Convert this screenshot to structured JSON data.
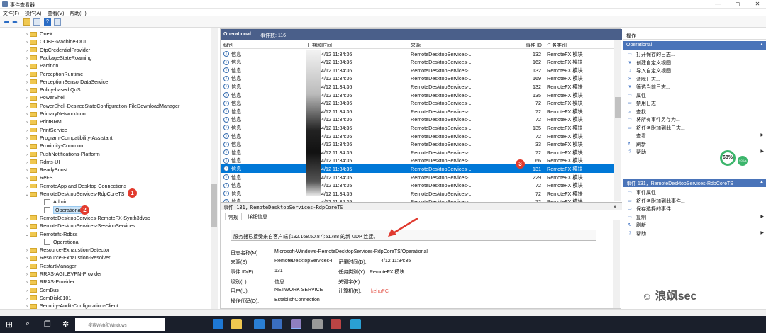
{
  "window": {
    "title": "事件查看器",
    "minimize": "—",
    "maximize": "◻",
    "close": "✕"
  },
  "menu": [
    "文件(F)",
    "操作(A)",
    "查看(V)",
    "帮助(H)"
  ],
  "tree": {
    "items": [
      {
        "label": "OneX",
        "type": "folder",
        "expander": "›",
        "indent": 0
      },
      {
        "label": "OOBE-Machine-DUI",
        "type": "folder",
        "expander": "›",
        "indent": 0
      },
      {
        "label": "OtpCredentialProvider",
        "type": "folder",
        "expander": "›",
        "indent": 0
      },
      {
        "label": "PackageStateRoaming",
        "type": "folder",
        "expander": "›",
        "indent": 0
      },
      {
        "label": "Partition",
        "type": "folder",
        "expander": "›",
        "indent": 0
      },
      {
        "label": "PerceptionRuntime",
        "type": "folder",
        "expander": "›",
        "indent": 0
      },
      {
        "label": "PerceptionSensorDataService",
        "type": "folder",
        "expander": "›",
        "indent": 0
      },
      {
        "label": "Policy-based QoS",
        "type": "folder",
        "expander": "›",
        "indent": 0
      },
      {
        "label": "PowerShell",
        "type": "folder",
        "expander": "›",
        "indent": 0
      },
      {
        "label": "PowerShell-DesiredStateConfiguration-FileDownloadManager",
        "type": "folder",
        "expander": "›",
        "indent": 0
      },
      {
        "label": "PrimaryNetworkIcon",
        "type": "folder",
        "expander": "›",
        "indent": 0
      },
      {
        "label": "PrintBRM",
        "type": "folder",
        "expander": "›",
        "indent": 0
      },
      {
        "label": "PrintService",
        "type": "folder",
        "expander": "›",
        "indent": 0
      },
      {
        "label": "Program-Compatibility-Assistant",
        "type": "folder",
        "expander": "›",
        "indent": 0
      },
      {
        "label": "Proximity-Common",
        "type": "folder",
        "expander": "›",
        "indent": 0
      },
      {
        "label": "PushNotifications-Platform",
        "type": "folder",
        "expander": "›",
        "indent": 0
      },
      {
        "label": "Rdms-UI",
        "type": "folder",
        "expander": "›",
        "indent": 0
      },
      {
        "label": "ReadyBoost",
        "type": "folder",
        "expander": "›",
        "indent": 0
      },
      {
        "label": "ReFS",
        "type": "folder",
        "expander": "›",
        "indent": 0
      },
      {
        "label": "RemoteApp and Desktop Connections",
        "type": "folder",
        "expander": "›",
        "indent": 0
      },
      {
        "label": "RemoteDesktopServices-RdpCoreTS",
        "type": "folder",
        "expander": "⌄",
        "indent": 0
      },
      {
        "label": "Admin",
        "type": "log",
        "expander": "",
        "indent": 1
      },
      {
        "label": "Operational",
        "type": "log",
        "expander": "",
        "indent": 1,
        "selected": true
      },
      {
        "label": "RemoteDesktopServices-RemoteFX-Synth3dvsc",
        "type": "folder",
        "expander": "›",
        "indent": 0
      },
      {
        "label": "RemoteDesktopServices-SessionServices",
        "type": "folder",
        "expander": "›",
        "indent": 0
      },
      {
        "label": "Remotefs-Rdbss",
        "type": "folder",
        "expander": "⌄",
        "indent": 0
      },
      {
        "label": "Operational",
        "type": "log",
        "expander": "",
        "indent": 1
      },
      {
        "label": "Resource-Exhaustion-Detector",
        "type": "folder",
        "expander": "›",
        "indent": 0
      },
      {
        "label": "Resource-Exhaustion-Resolver",
        "type": "folder",
        "expander": "›",
        "indent": 0
      },
      {
        "label": "RestartManager",
        "type": "folder",
        "expander": "›",
        "indent": 0
      },
      {
        "label": "RRAS-AGILEVPN-Provider",
        "type": "folder",
        "expander": "›",
        "indent": 0
      },
      {
        "label": "RRAS-Provider",
        "type": "folder",
        "expander": "›",
        "indent": 0
      },
      {
        "label": "ScmBus",
        "type": "folder",
        "expander": "›",
        "indent": 0
      },
      {
        "label": "ScmDisk0101",
        "type": "folder",
        "expander": "›",
        "indent": 0
      },
      {
        "label": "Security-Audit-Configuration-Client",
        "type": "folder",
        "expander": "›",
        "indent": 0
      }
    ]
  },
  "badges": [
    "1",
    "2",
    "3"
  ],
  "list": {
    "header_title": "Operational",
    "header_count": "事件数: 116",
    "columns": [
      "级别",
      "日期和时间",
      "来源",
      "事件 ID",
      "任务类别"
    ],
    "rows": [
      [
        "信息",
        "4/12 11:34:36",
        "RemoteDesktopServices-...",
        "132",
        "RemoteFX 模块"
      ],
      [
        "信息",
        "4/12 11:34:36",
        "RemoteDesktopServices-...",
        "162",
        "RemoteFX 模块"
      ],
      [
        "信息",
        "4/12 11:34:36",
        "RemoteDesktopServices-...",
        "132",
        "RemoteFX 模块"
      ],
      [
        "信息",
        "4/12 11:34:36",
        "RemoteDesktopServices-...",
        "169",
        "RemoteFX 模块"
      ],
      [
        "信息",
        "4/12 11:34:36",
        "RemoteDesktopServices-...",
        "132",
        "RemoteFX 模块"
      ],
      [
        "信息",
        "4/12 11:34:36",
        "RemoteDesktopServices-...",
        "135",
        "RemoteFX 模块"
      ],
      [
        "信息",
        "4/12 11:34:36",
        "RemoteDesktopServices-...",
        "72",
        "RemoteFX 模块"
      ],
      [
        "信息",
        "4/12 11:34:36",
        "RemoteDesktopServices-...",
        "72",
        "RemoteFX 模块"
      ],
      [
        "信息",
        "4/12 11:34:36",
        "RemoteDesktopServices-...",
        "72",
        "RemoteFX 模块"
      ],
      [
        "信息",
        "4/12 11:34:36",
        "RemoteDesktopServices-...",
        "135",
        "RemoteFX 模块"
      ],
      [
        "信息",
        "4/12 11:34:36",
        "RemoteDesktopServices-...",
        "72",
        "RemoteFX 模块"
      ],
      [
        "信息",
        "4/12 11:34:36",
        "RemoteDesktopServices-...",
        "33",
        "RemoteFX 模块"
      ],
      [
        "信息",
        "4/12 11:34:35",
        "RemoteDesktopServices-...",
        "72",
        "RemoteFX 模块"
      ],
      [
        "信息",
        "4/12 11:34:35",
        "RemoteDesktopServices-...",
        "66",
        "RemoteFX 模块"
      ],
      [
        "信息",
        "4/12 11:34:35",
        "RemoteDesktopServices-...",
        "131",
        "RemoteFX 模块"
      ],
      [
        "信息",
        "4/12 11:34:35",
        "RemoteDesktopServices-...",
        "229",
        "RemoteFX 模块"
      ],
      [
        "信息",
        "4/12 11:34:35",
        "RemoteDesktopServices-...",
        "72",
        "RemoteFX 模块"
      ],
      [
        "信息",
        "4/12 11:34:35",
        "RemoteDesktopServices-...",
        "72",
        "RemoteFX 模块"
      ],
      [
        "信息",
        "4/12 11:34:35",
        "RemoteDesktopServices-...",
        "72",
        "RemoteFX 模块"
      ]
    ],
    "selected_row": 14
  },
  "detail": {
    "header": "事件 131，RemoteDesktopServices-RdpCoreTS",
    "tabs": [
      "常规",
      "详细信息"
    ],
    "message": "服务器已接受来自客户端 [192.168.50.87]:51788 的新 UDP 连接。",
    "fields": {
      "log_name_label": "日志名称(M):",
      "log_name": "Microsoft-Windows-RemoteDesktopServices-RdpCoreTS/Operational",
      "source_label": "来源(S):",
      "source": "RemoteDesktopServices-I",
      "logged_label": "记录时间(D):",
      "logged": "4/12 11:34:35",
      "event_id_label": "事件 ID(E):",
      "event_id": "131",
      "task_label": "任务类别(Y):",
      "task": "RemoteFX 模块",
      "level_label": "级别(L):",
      "level": "信息",
      "keywords_label": "关键字(K):",
      "user_label": "用户(U):",
      "user": "NETWORK SERVICE",
      "computer_label": "计算机(R):",
      "computer": "kehuPC",
      "opcode_label": "操作代码(O):",
      "opcode": "EstablishConnection"
    }
  },
  "actions": {
    "header": "操作",
    "section1": "Operational",
    "items1": [
      "打开保存的日志...",
      "创建自定义视图...",
      "导入自定义视图...",
      "清除日志...",
      "筛选当前日志...",
      "属性",
      "禁用日志",
      "查找...",
      "将所有事件另存为...",
      "将任务附加到此日志...",
      "查看",
      "刷新",
      "帮助"
    ],
    "section2": "事件 131，RemoteDesktopServices-RdpCoreTS",
    "items2": [
      "事件属性",
      "将任务附加到此事件...",
      "保存选择的事件...",
      "复制",
      "刷新",
      "帮助"
    ]
  },
  "gauge": {
    "percent": "68%",
    "sub": "↑ 0K/s"
  },
  "watermark": "浪飒sec",
  "taskbar": {
    "search_placeholder": "搜索Web和Windows"
  }
}
